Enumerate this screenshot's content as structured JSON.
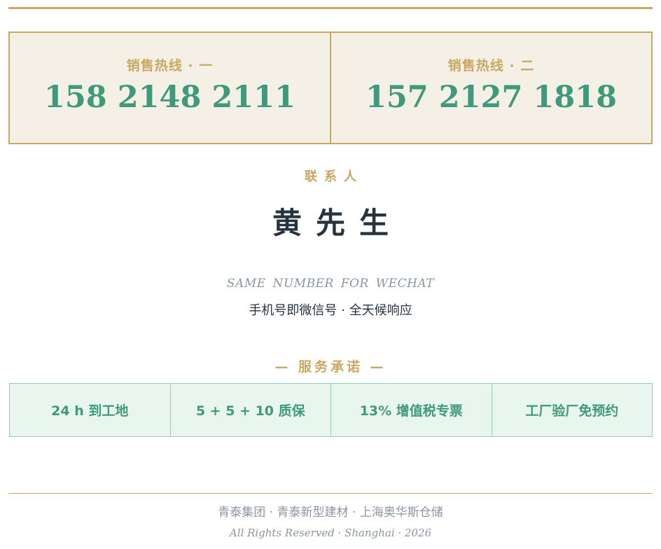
{
  "hotlines": [
    {
      "label": "销售热线 · 一",
      "number": "158 2148 2111"
    },
    {
      "label": "销售热线 · 二",
      "number": "157 2127 1818"
    }
  ],
  "contact": {
    "label": "联系人",
    "name": "黄先生"
  },
  "wechat": {
    "english": "SAME NUMBER FOR WECHAT",
    "chinese": "手机号即微信号 · 全天候响应"
  },
  "services": {
    "heading": "— 服务承诺 —",
    "items": [
      "24 h 到工地",
      "5 + 5 + 10 质保",
      "13% 增值税专票",
      "工厂验厂免预约"
    ]
  },
  "footer": {
    "companies": "青泰集团 · 青泰新型建材 · 上海奥华斯仓储",
    "rights": "All Rights Reserved · Shanghai · 2026"
  },
  "colors": {
    "gold": "#c9a862",
    "green": "#3f9a7c",
    "dark": "#25343f",
    "gray": "#8a96a3",
    "cream": "#f5f0e6",
    "mint": "#e9f5ef"
  }
}
